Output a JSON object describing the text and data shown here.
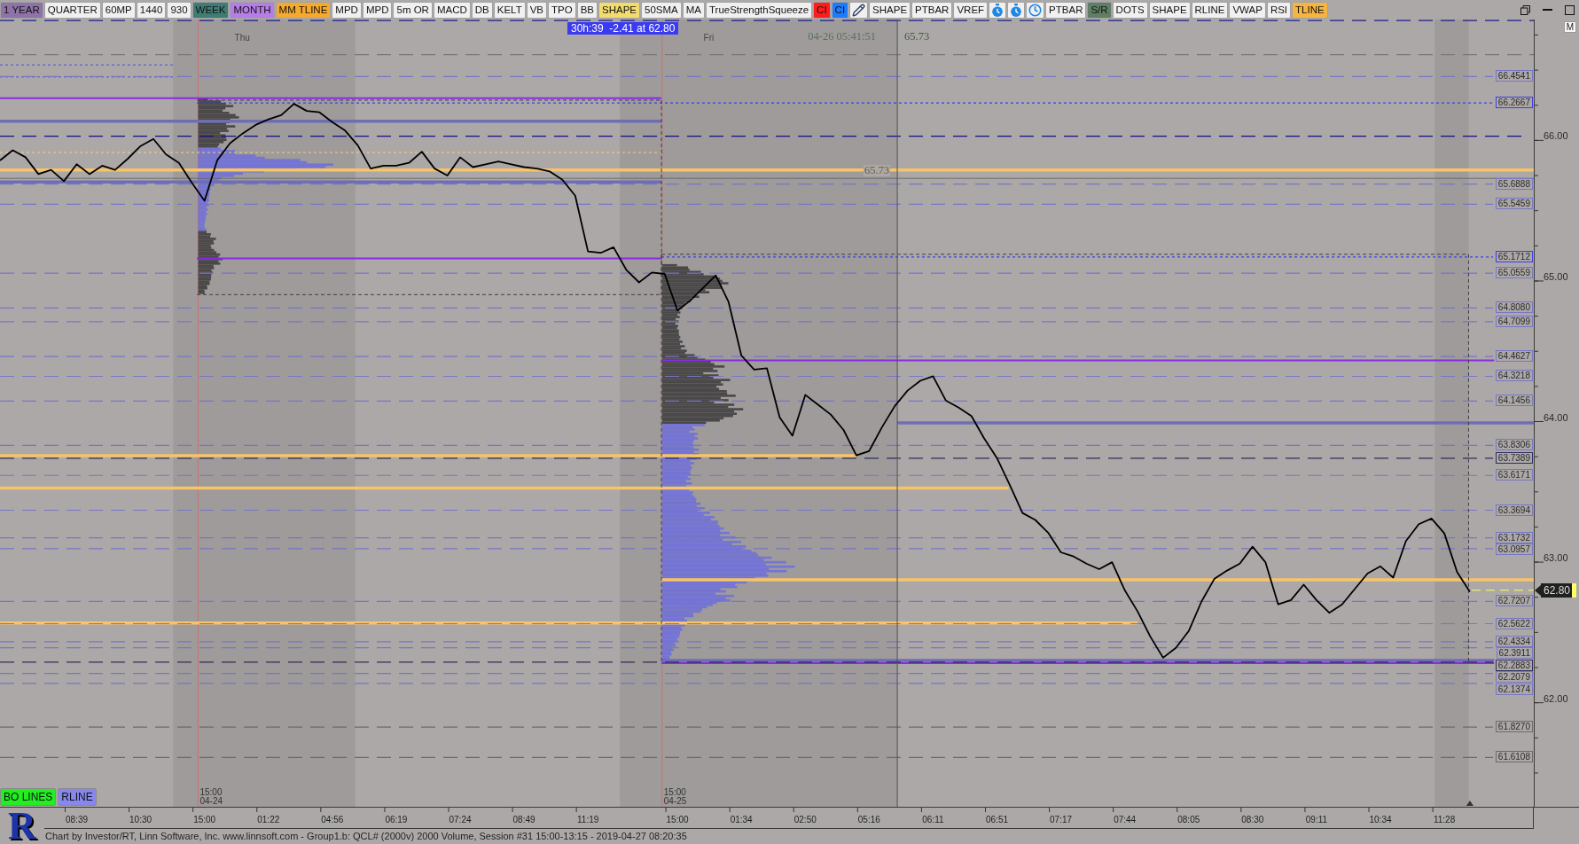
{
  "toolbar": {
    "buttons": [
      {
        "kind": "text",
        "label": "1 YEAR",
        "color": "#8e72a8"
      },
      {
        "kind": "text",
        "label": "QUARTER"
      },
      {
        "kind": "text",
        "label": "60MP"
      },
      {
        "kind": "text",
        "label": "1440"
      },
      {
        "kind": "text",
        "label": "930"
      },
      {
        "kind": "text",
        "label": "WEEK",
        "color": "#3e7c74"
      },
      {
        "kind": "text",
        "label": "MONTH",
        "color": "#b67de6"
      },
      {
        "kind": "text",
        "label": "MM TLINE",
        "color": "#f7a92e"
      },
      {
        "kind": "text",
        "label": "MPD"
      },
      {
        "kind": "text",
        "label": "MPD"
      },
      {
        "kind": "text",
        "label": "5m OR"
      },
      {
        "kind": "text",
        "label": "MACD"
      },
      {
        "kind": "text",
        "label": "DB"
      },
      {
        "kind": "text",
        "label": "KELT"
      },
      {
        "kind": "text",
        "label": "VB"
      },
      {
        "kind": "text",
        "label": "TPO"
      },
      {
        "kind": "text",
        "label": "BB"
      },
      {
        "kind": "text",
        "label": "SHAPE",
        "color": "#f2dc6e"
      },
      {
        "kind": "text",
        "label": "50SMA"
      },
      {
        "kind": "text",
        "label": "MA"
      },
      {
        "kind": "text",
        "label": "TrueStrengthSqueeze"
      },
      {
        "kind": "text",
        "label": "CI",
        "color": "#ff1c1c"
      },
      {
        "kind": "text",
        "label": "CI",
        "color": "#1c7cff"
      },
      {
        "kind": "pencil"
      },
      {
        "kind": "text",
        "label": "SHAPE"
      },
      {
        "kind": "text",
        "label": "PTBAR"
      },
      {
        "kind": "text",
        "label": "VREF"
      },
      {
        "kind": "stopwatch"
      },
      {
        "kind": "stopwatch"
      },
      {
        "kind": "clock"
      },
      {
        "kind": "text",
        "label": "PTBAR"
      },
      {
        "kind": "text",
        "label": "S/R",
        "color": "#5f7e64"
      },
      {
        "kind": "text",
        "label": "DOTS"
      },
      {
        "kind": "text",
        "label": "SHAPE"
      },
      {
        "kind": "text",
        "label": "RLINE"
      },
      {
        "kind": "text",
        "label": "VWAP"
      },
      {
        "kind": "text",
        "label": "RSI"
      },
      {
        "kind": "text",
        "label": "TLINE",
        "color": "#f6b541"
      }
    ]
  },
  "chart": {
    "info_box": "30h:39  -2.41 at 62.80",
    "cursor_readout": {
      "time": "04-26 05:41:51",
      "price": "65.73"
    },
    "crosshair_label": "65.73",
    "last_price": "62.80",
    "days": [
      "Thu",
      "Fri"
    ],
    "sessions": [
      {
        "time": "15:00",
        "date": "04-24"
      },
      {
        "time": "15:00",
        "date": "04-25"
      }
    ],
    "corner_button": "M",
    "overlay_buttons": [
      {
        "label": "BO LINES",
        "color": "#22ee22"
      },
      {
        "label": "RLINE",
        "color": "#8787ee"
      }
    ],
    "chart_data": {
      "type": "line",
      "ylim": [
        61.26,
        66.86
      ],
      "categories": [
        null,
        null,
        null,
        null,
        null,
        null,
        "08:39",
        null,
        null,
        null,
        null,
        "10:30",
        null,
        null,
        null,
        null,
        "15:00",
        null,
        null,
        null,
        null,
        "01:22",
        null,
        null,
        null,
        null,
        "04:56",
        null,
        null,
        null,
        null,
        "06:19",
        null,
        null,
        null,
        null,
        "07:24",
        null,
        null,
        null,
        null,
        "08:49",
        null,
        null,
        null,
        null,
        "11:19",
        null,
        null,
        null,
        null,
        null,
        null,
        "15:00",
        null,
        null,
        null,
        null,
        "01:34",
        null,
        null,
        null,
        null,
        "02:50",
        null,
        null,
        null,
        null,
        "05:16",
        null,
        null,
        null,
        null,
        "06:11",
        null,
        null,
        null,
        null,
        "06:51",
        null,
        null,
        null,
        null,
        "07:17",
        null,
        null,
        null,
        null,
        "07:44",
        null,
        null,
        null,
        null,
        "08:05",
        null,
        null,
        null,
        null,
        "08:30",
        null,
        null,
        null,
        null,
        "09:11",
        null,
        null,
        null,
        null,
        "10:34",
        null,
        null,
        null,
        null,
        "11:28",
        null,
        null
      ],
      "series": [
        {
          "color": "#000000",
          "values": [
            65.857,
            65.93,
            65.88,
            65.76,
            65.79,
            65.71,
            65.83,
            65.76,
            65.82,
            65.79,
            65.87,
            65.96,
            66.01,
            65.9,
            65.84,
            65.7,
            65.57,
            65.86,
            65.98,
            66.05,
            66.11,
            66.15,
            66.18,
            66.26,
            66.21,
            66.2,
            66.13,
            66.07,
            65.964,
            65.8,
            65.82,
            65.82,
            65.84,
            65.92,
            65.8,
            65.75,
            65.88,
            65.81,
            65.83,
            65.85,
            65.83,
            65.81,
            65.8,
            65.78,
            65.72,
            65.606,
            65.21,
            65.2,
            65.24,
            65.08,
            64.99,
            65.06,
            65.05,
            64.79,
            64.86,
            64.95,
            65.04,
            64.85,
            64.47,
            64.37,
            64.38,
            64.03,
            63.9,
            64.19,
            64.12,
            64.05,
            63.94,
            63.76,
            63.79,
            63.96,
            64.11,
            64.22,
            64.29,
            64.323,
            64.15,
            64.1,
            64.04,
            63.88,
            63.74,
            63.55,
            63.35,
            63.3,
            63.21,
            63.07,
            63.04,
            62.99,
            62.95,
            63.0,
            62.8,
            62.65,
            62.47,
            62.32,
            62.39,
            62.51,
            62.72,
            62.88,
            62.94,
            62.99,
            63.11,
            63.0,
            62.7,
            62.73,
            62.84,
            62.73,
            62.64,
            62.7,
            62.81,
            62.92,
            62.97,
            62.89,
            63.15,
            63.27,
            63.31,
            63.205,
            62.93,
            62.789
          ]
        }
      ],
      "yticks": [
        {
          "value": 62,
          "label": "62.00"
        },
        {
          "value": 63,
          "label": "63.00"
        },
        {
          "value": 64,
          "label": "64.00"
        },
        {
          "value": 65,
          "label": "65.00"
        },
        {
          "value": 66,
          "label": "66.00"
        }
      ],
      "ref_lines": [
        {
          "axis": "y",
          "value": 66.4541,
          "label": "66.4541",
          "color": "#7676c6"
        },
        {
          "axis": "y",
          "value": 66.2667,
          "label": "66.2667",
          "color": "#3c3cf0"
        },
        {
          "axis": "y",
          "value": 65.6888,
          "label": "65.6888",
          "color": "#7676c6"
        },
        {
          "axis": "y",
          "value": 65.5459,
          "label": "65.5459",
          "color": "#7676c6"
        },
        {
          "axis": "y",
          "value": 65.1712,
          "label": "65.1712",
          "color": "#3c3cf0"
        },
        {
          "axis": "y",
          "value": 65.0559,
          "label": "65.0559",
          "color": "#7676c6"
        },
        {
          "axis": "y",
          "value": 64.808,
          "label": "64.8080",
          "color": "#7676c6"
        },
        {
          "axis": "y",
          "value": 64.7099,
          "label": "64.7099",
          "color": "#7676c6"
        },
        {
          "axis": "y",
          "value": 64.4627,
          "label": "64.4627",
          "color": "#7676c6"
        },
        {
          "axis": "y",
          "value": 64.3218,
          "label": "64.3218",
          "color": "#7676c6"
        },
        {
          "axis": "y",
          "value": 64.1456,
          "label": "64.1456",
          "color": "#7676c6"
        },
        {
          "axis": "y",
          "value": 63.8306,
          "label": "63.8306",
          "color": "#7676c6"
        },
        {
          "axis": "y",
          "value": 63.7389,
          "label": "63.7389",
          "color": "#2e2e5e"
        },
        {
          "axis": "y",
          "value": 63.6171,
          "label": "63.6171",
          "color": "#7676c6"
        },
        {
          "axis": "y",
          "value": 63.3694,
          "label": "63.3694",
          "color": "#7676c6"
        },
        {
          "axis": "y",
          "value": 63.1732,
          "label": "63.1732",
          "color": "#7676c6"
        },
        {
          "axis": "y",
          "value": 63.0957,
          "label": "63.0957",
          "color": "#7676c6"
        },
        {
          "axis": "y",
          "value": 62.7207,
          "label": "62.7207",
          "color": "#7676c6"
        },
        {
          "axis": "y",
          "value": 62.5622,
          "label": "62.5622",
          "color": "#7676c6"
        },
        {
          "axis": "y",
          "value": 62.4334,
          "label": "62.4334",
          "color": "#7676c6"
        },
        {
          "axis": "y",
          "value": 62.3911,
          "label": "62.3911",
          "color": "#7676c6"
        },
        {
          "axis": "y",
          "value": 62.2883,
          "label": "62.2883",
          "color": "#2e2e5e"
        },
        {
          "axis": "y",
          "value": 62.2079,
          "label": "62.2079",
          "color": "#7676c6"
        },
        {
          "axis": "y",
          "value": 62.1374,
          "label": "62.1374",
          "color": "#7676c6"
        },
        {
          "axis": "y",
          "value": 61.827,
          "label": "61.8270",
          "color": "#6e6a6a"
        },
        {
          "axis": "y",
          "value": 61.6108,
          "label": "61.6108",
          "color": "#6e6a6a"
        },
        {
          "axis": "y",
          "value": 66.853,
          "color": "#1c1c8c"
        },
        {
          "axis": "y",
          "value": 66.61,
          "color": "#7c7878"
        },
        {
          "axis": "y",
          "value": 66.3,
          "color": "#8a2be2"
        },
        {
          "axis": "y",
          "value": 66.136,
          "color": "#6e6eb4"
        },
        {
          "axis": "y",
          "value": 66.03,
          "color": "#10108a"
        },
        {
          "axis": "y",
          "value": 65.914,
          "color": "#f2d27a"
        },
        {
          "axis": "y",
          "value": 65.79,
          "color": "#f7c468"
        },
        {
          "axis": "y",
          "value": 65.705,
          "color": "#6e6eb4"
        },
        {
          "axis": "y",
          "value": 65.16,
          "color": "#8a2be2"
        },
        {
          "axis": "y",
          "value": 64.435,
          "color": "#8a2be2"
        },
        {
          "axis": "y",
          "value": 63.99,
          "color": "#6e6eb4"
        },
        {
          "axis": "y",
          "value": 63.757,
          "color": "#f7c468"
        },
        {
          "axis": "y",
          "value": 63.527,
          "color": "#f7c468"
        },
        {
          "axis": "y",
          "value": 62.875,
          "color": "#f7c468"
        },
        {
          "axis": "y",
          "value": 62.567,
          "color": "#f7c468"
        },
        {
          "axis": "y",
          "value": 62.3,
          "color": "#6e6eb4"
        },
        {
          "axis": "y",
          "value": 62.282,
          "color": "#8a2be2"
        },
        {
          "axis": "y",
          "value": 65.73,
          "color": "#6c6c6c"
        },
        {
          "axis": "y",
          "value": 66.537,
          "color": "#4a4af0"
        },
        {
          "axis": "y",
          "value": 66.451,
          "color": "#4a4af0"
        },
        {
          "axis": "y",
          "value": 66.286,
          "color": "#404040"
        },
        {
          "axis": "y",
          "value": 64.903,
          "color": "#404040"
        },
        {
          "axis": "y",
          "value": 65.19,
          "color": "#404040"
        }
      ]
    }
  },
  "footer": {
    "logo": "R",
    "text": "Chart by Investor/RT, Linn Software, Inc. www.linnsoft.com - Group1.b: QCL# (2000v) 2000 Volume, Session #31 15:00-13:15 - 2019-04-27 08:20:35"
  }
}
